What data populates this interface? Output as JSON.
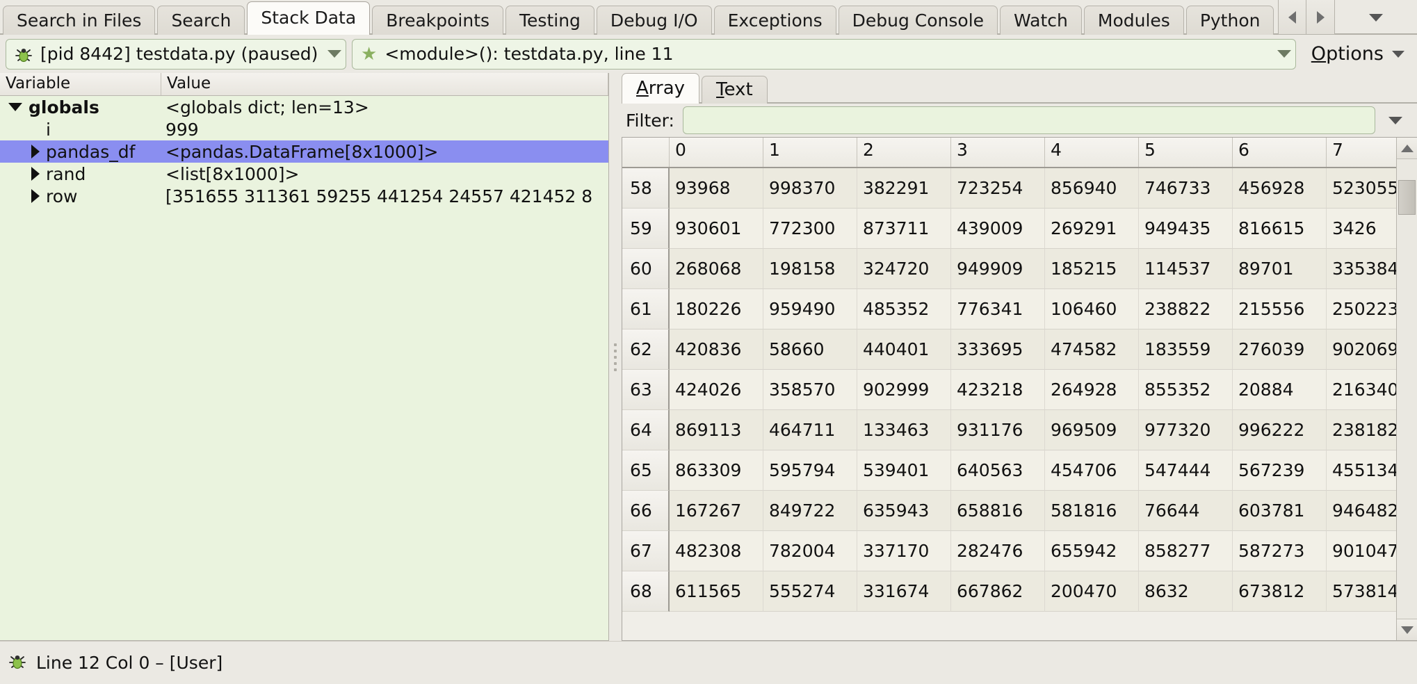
{
  "tabbar": {
    "tabs": [
      {
        "label": "Search in Files",
        "active": false
      },
      {
        "label": "Search",
        "active": false
      },
      {
        "label": "Stack Data",
        "active": true
      },
      {
        "label": "Breakpoints",
        "active": false
      },
      {
        "label": "Testing",
        "active": false
      },
      {
        "label": "Debug I/O",
        "active": false
      },
      {
        "label": "Exceptions",
        "active": false
      },
      {
        "label": "Debug Console",
        "active": false
      },
      {
        "label": "Watch",
        "active": false
      },
      {
        "label": "Modules",
        "active": false
      },
      {
        "label": "Python",
        "active": false
      }
    ],
    "scroll_left_icon": "chevron-left-icon",
    "scroll_right_icon": "chevron-right-icon",
    "menu_icon": "chevron-down-icon"
  },
  "toolbar": {
    "process": {
      "icon": "bug-icon",
      "value": "[pid 8442] testdata.py (paused)"
    },
    "frame": {
      "icon": "star-icon",
      "value": "<module>(): testdata.py, line 11"
    },
    "options": {
      "label_mnemonic": "O",
      "label_rest": "ptions"
    }
  },
  "tree": {
    "columns": [
      "Variable",
      "Value"
    ],
    "rows": [
      {
        "name": "globals",
        "value": "<globals dict; len=13>",
        "indent": 0,
        "twisty": "open",
        "bold": true,
        "selected": false
      },
      {
        "name": "i",
        "value": "999",
        "indent": 1,
        "twisty": "none",
        "bold": false,
        "selected": false
      },
      {
        "name": "pandas_df",
        "value": "<pandas.DataFrame[8x1000]>",
        "indent": 1,
        "twisty": "closed",
        "bold": false,
        "selected": true
      },
      {
        "name": "rand",
        "value": "<list[8x1000]>",
        "indent": 1,
        "twisty": "closed",
        "bold": false,
        "selected": false
      },
      {
        "name": "row",
        "value": "[351655 311361  59255 441254  24557 421452 8",
        "indent": 1,
        "twisty": "closed",
        "bold": false,
        "selected": false
      }
    ]
  },
  "array_viewer": {
    "tabs": [
      {
        "label_mnemonic": "A",
        "label_rest": "rray",
        "active": true
      },
      {
        "label_mnemonic": "T",
        "label_rest": "ext",
        "active": false
      }
    ],
    "filter": {
      "label": "Filter:",
      "value": "",
      "placeholder": ""
    },
    "grid": {
      "column_headers": [
        "0",
        "1",
        "2",
        "3",
        "4",
        "5",
        "6",
        "7"
      ],
      "row_headers": [
        "58",
        "59",
        "60",
        "61",
        "62",
        "63",
        "64",
        "65",
        "66",
        "67",
        "68"
      ],
      "rows": [
        [
          "93968",
          "998370",
          "382291",
          "723254",
          "856940",
          "746733",
          "456928",
          "523055"
        ],
        [
          "930601",
          "772300",
          "873711",
          "439009",
          "269291",
          "949435",
          "816615",
          "3426"
        ],
        [
          "268068",
          "198158",
          "324720",
          "949909",
          "185215",
          "114537",
          "89701",
          "335384"
        ],
        [
          "180226",
          "959490",
          "485352",
          "776341",
          "106460",
          "238822",
          "215556",
          "250223"
        ],
        [
          "420836",
          "58660",
          "440401",
          "333695",
          "474582",
          "183559",
          "276039",
          "902069"
        ],
        [
          "424026",
          "358570",
          "902999",
          "423218",
          "264928",
          "855352",
          "20884",
          "216340"
        ],
        [
          "869113",
          "464711",
          "133463",
          "931176",
          "969509",
          "977320",
          "996222",
          "238182"
        ],
        [
          "863309",
          "595794",
          "539401",
          "640563",
          "454706",
          "547444",
          "567239",
          "455134"
        ],
        [
          "167267",
          "849722",
          "635943",
          "658816",
          "581816",
          "76644",
          "603781",
          "946482"
        ],
        [
          "482308",
          "782004",
          "337170",
          "282476",
          "655942",
          "858277",
          "587273",
          "901047"
        ],
        [
          "611565",
          "555274",
          "331674",
          "667862",
          "200470",
          "8632",
          "673812",
          "573814"
        ]
      ]
    },
    "scrollbar": {
      "up_icon": "triangle-up-icon",
      "down_icon": "triangle-down-icon"
    }
  },
  "statusbar": {
    "icon": "bug-icon",
    "text": "Line 12 Col 0 – [User]"
  },
  "colors": {
    "window_bg": "#ebe9e3",
    "tree_bg": "#eaf3de",
    "selection": "#8a8ef0",
    "field_bg": "#eef5e6",
    "field_border": "#a9b89c",
    "grid_even": "#eceadf",
    "grid_odd": "#f2f0e7",
    "accent_star": "#8ab060"
  }
}
